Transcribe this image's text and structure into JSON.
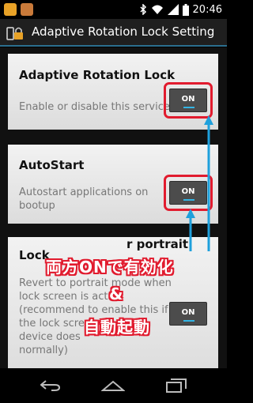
{
  "status_bar": {
    "time": "20:46",
    "icons": [
      "notification-app-icon",
      "notification-app-icon",
      "bluetooth-icon",
      "wifi-icon",
      "signal-icon",
      "battery-icon"
    ]
  },
  "action_bar": {
    "title": "Adaptive Rotation Lock Setting",
    "icon": "lock-rotation-app-icon"
  },
  "settings": [
    {
      "title": "Adaptive Rotation Lock",
      "description": "Enable or disable this service",
      "toggle": "ON",
      "highlighted": true
    },
    {
      "title": "AutoStart",
      "description_lines": [
        "Autostart applications on",
        "bootup"
      ],
      "toggle": "ON",
      "highlighted": true
    },
    {
      "title_partial": "Lock",
      "title_tail": "r portrait",
      "description_lines": [
        "Revert to portrait mode when",
        "lock screen is activa",
        "(recommend to enable this if",
        "the lock scre",
        "device does",
        "normally)"
      ],
      "toggle": "ON",
      "highlighted": false
    }
  ],
  "annotation": {
    "line1": "両方ONで有効化",
    "line2": "&",
    "line3": "自動起動",
    "color": "#e11b2e",
    "arrow_color": "#1ea0dc"
  },
  "nav_bar": {
    "buttons": [
      "back-icon",
      "home-icon",
      "recent-apps-icon"
    ]
  }
}
